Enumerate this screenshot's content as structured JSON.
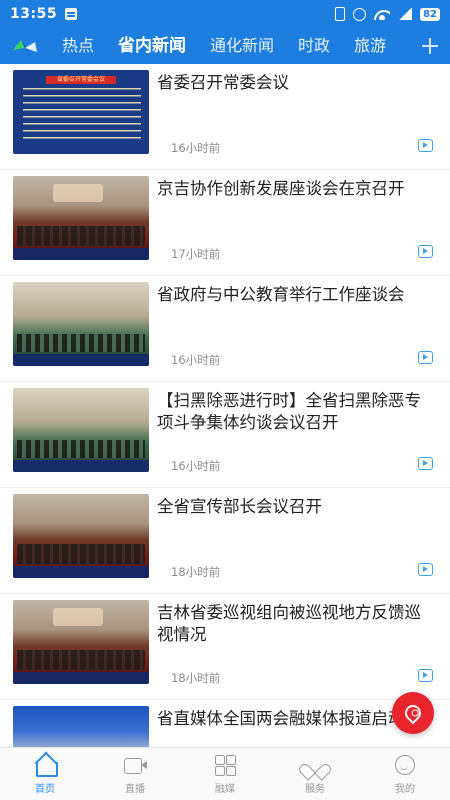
{
  "status_bar": {
    "time": "13:55",
    "battery": "82"
  },
  "tabs": [
    {
      "label": "热点",
      "active": false
    },
    {
      "label": "省内新闻",
      "active": true
    },
    {
      "label": "通化新闻",
      "active": false
    },
    {
      "label": "时政",
      "active": false
    },
    {
      "label": "旅游",
      "active": false
    }
  ],
  "news": [
    {
      "title": "省委召开常委会议",
      "time": "16小时前",
      "thumb_caption": "省委召开常委会议",
      "has_video": true
    },
    {
      "title": "京吉协作创新发展座谈会在京召开",
      "time": "17小时前",
      "has_video": true
    },
    {
      "title": "省政府与中公教育举行工作座谈会",
      "time": "16小时前",
      "has_video": true
    },
    {
      "title": "【扫黑除恶进行时】全省扫黑除恶专项斗争集体约谈会议召开",
      "time": "16小时前",
      "has_video": true
    },
    {
      "title": "全省宣传部长会议召开",
      "time": "18小时前",
      "has_video": true
    },
    {
      "title": "吉林省委巡视组向被巡视地方反馈巡视情况",
      "time": "18小时前",
      "has_video": true
    },
    {
      "title": "省直媒体全国两会融媒体报道启动",
      "time": "",
      "has_video": false
    }
  ],
  "bottom_nav": [
    {
      "label": "首页",
      "icon": "home-icon",
      "active": true
    },
    {
      "label": "直播",
      "icon": "live-camera-icon",
      "active": false
    },
    {
      "label": "融媒",
      "icon": "media-grid-icon",
      "active": false
    },
    {
      "label": "服务",
      "icon": "service-heart-icon",
      "active": false
    },
    {
      "label": "我的",
      "icon": "profile-smiley-icon",
      "active": false
    }
  ],
  "colors": {
    "brand_blue": "#1d7ee0",
    "active_nav": "#2c8bea",
    "fab_red": "#e9242d",
    "play_icon": "#3ea1f0"
  }
}
